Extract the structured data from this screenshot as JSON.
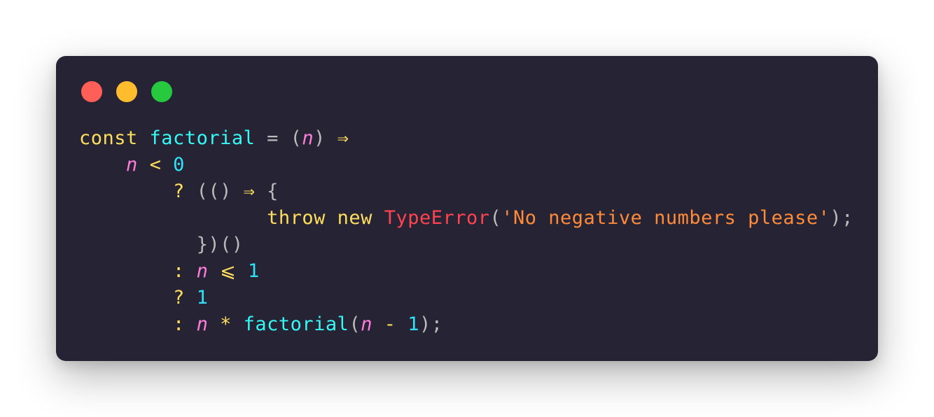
{
  "window": {
    "background": "#262335",
    "controls": [
      {
        "name": "close",
        "color": "#ff5f56"
      },
      {
        "name": "minimize",
        "color": "#ffbd2e"
      },
      {
        "name": "maximize",
        "color": "#27c93f"
      }
    ]
  },
  "theme": {
    "keyword": "#fede5d",
    "function": "#36f9f6",
    "parameter": "#ff7edb",
    "number": "#2ee2fa",
    "class": "#fe4450",
    "string": "#ff8b39",
    "punctuation": "#bbbbbb"
  },
  "code": {
    "language": "javascript",
    "lines": [
      [
        {
          "t": "const",
          "k": "kw"
        },
        {
          "t": " ",
          "k": "plain"
        },
        {
          "t": "factorial",
          "k": "fn"
        },
        {
          "t": " = (",
          "k": "punc"
        },
        {
          "t": "n",
          "k": "param"
        },
        {
          "t": ") ",
          "k": "punc"
        },
        {
          "t": "⇒",
          "k": "op"
        }
      ],
      [
        {
          "t": "    ",
          "k": "plain"
        },
        {
          "t": "n",
          "k": "param"
        },
        {
          "t": " ",
          "k": "plain"
        },
        {
          "t": "<",
          "k": "op"
        },
        {
          "t": " ",
          "k": "plain"
        },
        {
          "t": "0",
          "k": "num"
        }
      ],
      [
        {
          "t": "        ",
          "k": "plain"
        },
        {
          "t": "?",
          "k": "op"
        },
        {
          "t": " (() ",
          "k": "punc"
        },
        {
          "t": "⇒",
          "k": "op"
        },
        {
          "t": " {",
          "k": "punc"
        }
      ],
      [
        {
          "t": "                ",
          "k": "plain"
        },
        {
          "t": "throw",
          "k": "kw"
        },
        {
          "t": " ",
          "k": "plain"
        },
        {
          "t": "new",
          "k": "kw"
        },
        {
          "t": " ",
          "k": "plain"
        },
        {
          "t": "TypeError",
          "k": "class"
        },
        {
          "t": "(",
          "k": "punc"
        },
        {
          "t": "'No negative numbers please'",
          "k": "str"
        },
        {
          "t": ");",
          "k": "punc"
        }
      ],
      [
        {
          "t": "          ",
          "k": "plain"
        },
        {
          "t": "})()",
          "k": "punc"
        }
      ],
      [
        {
          "t": "        ",
          "k": "plain"
        },
        {
          "t": ":",
          "k": "op"
        },
        {
          "t": " ",
          "k": "plain"
        },
        {
          "t": "n",
          "k": "param"
        },
        {
          "t": " ",
          "k": "plain"
        },
        {
          "t": "⩽",
          "k": "op"
        },
        {
          "t": " ",
          "k": "plain"
        },
        {
          "t": "1",
          "k": "num"
        }
      ],
      [
        {
          "t": "        ",
          "k": "plain"
        },
        {
          "t": "?",
          "k": "op"
        },
        {
          "t": " ",
          "k": "plain"
        },
        {
          "t": "1",
          "k": "num"
        }
      ],
      [
        {
          "t": "        ",
          "k": "plain"
        },
        {
          "t": ":",
          "k": "op"
        },
        {
          "t": " ",
          "k": "plain"
        },
        {
          "t": "n",
          "k": "param"
        },
        {
          "t": " ",
          "k": "plain"
        },
        {
          "t": "*",
          "k": "op"
        },
        {
          "t": " ",
          "k": "plain"
        },
        {
          "t": "factorial",
          "k": "fn"
        },
        {
          "t": "(",
          "k": "punc"
        },
        {
          "t": "n",
          "k": "param"
        },
        {
          "t": " ",
          "k": "plain"
        },
        {
          "t": "-",
          "k": "op"
        },
        {
          "t": " ",
          "k": "plain"
        },
        {
          "t": "1",
          "k": "num"
        },
        {
          "t": ");",
          "k": "punc"
        }
      ]
    ]
  }
}
